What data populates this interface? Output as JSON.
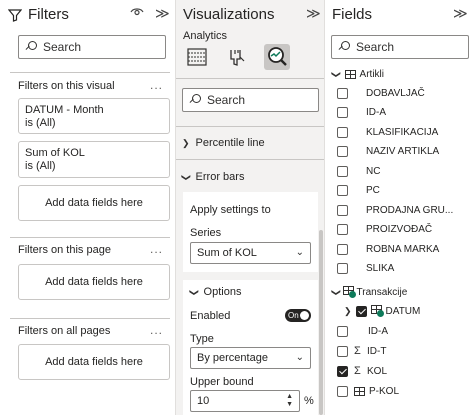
{
  "filters": {
    "title": "Filters",
    "search_placeholder": "Search",
    "on_visual_label": "Filters on this visual",
    "visual_cards": [
      {
        "line1": "DATUM - Month",
        "line2": "is (All)"
      },
      {
        "line1": "Sum of KOL",
        "line2": "is (All)"
      }
    ],
    "add_label": "Add data fields here",
    "on_page_label": "Filters on this page",
    "all_pages_label": "Filters on all pages",
    "more": "..."
  },
  "viz": {
    "title": "Visualizations",
    "analytics_label": "Analytics",
    "search_placeholder": "Search",
    "percentile_label": "Percentile line",
    "error_bars_label": "Error bars",
    "apply_label": "Apply settings to",
    "series_label": "Series",
    "series_value": "Sum of KOL",
    "options_label": "Options",
    "enabled_label": "Enabled",
    "toggle_label": "On",
    "type_label": "Type",
    "type_value": "By percentage",
    "upper_label": "Upper bound",
    "upper_value": "10",
    "unit": "%"
  },
  "fields": {
    "title": "Fields",
    "search_placeholder": "Search",
    "table1": "Artikli",
    "artikli_fields": [
      "DOBAVLJAČ",
      "ID-A",
      "KLASIFIKACIJA",
      "NAZIV ARTIKLA",
      "NC",
      "PC",
      "PRODAJNA GRU...",
      "PROIZVOĐAČ",
      "ROBNA MARKA",
      "SLIKA"
    ],
    "table2": "Transakcije",
    "trans_fields": [
      {
        "name": "DATUM",
        "checked": true
      },
      {
        "name": "ID-A",
        "checked": false
      },
      {
        "name": "ID-T",
        "checked": false
      },
      {
        "name": "KOL",
        "checked": true
      },
      {
        "name": "P-KOL",
        "checked": false
      }
    ]
  }
}
